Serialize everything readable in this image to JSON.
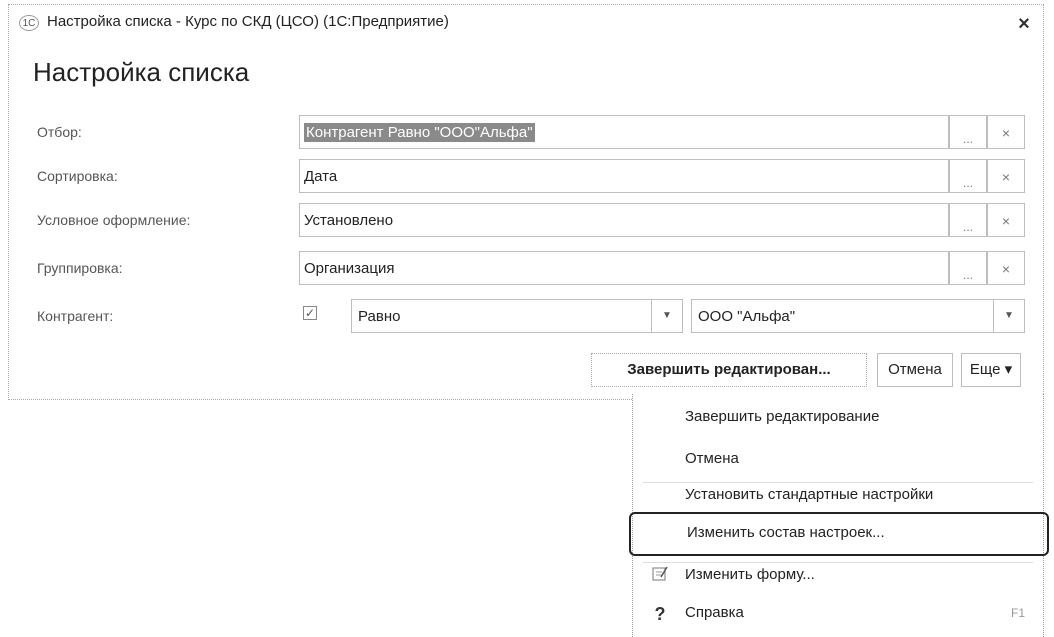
{
  "window": {
    "title": "Настройка списка - Курс по СКД (ЦСО)  (1С:Предприятие)",
    "app_icon": "1С",
    "close_glyph": "×"
  },
  "form": {
    "title": "Настройка списка",
    "rows": [
      {
        "label": "Отбор:",
        "value": "Контрагент Равно \"ООО\"Альфа\"",
        "dots": "...",
        "clear": "×"
      },
      {
        "label": "Сортировка:",
        "value": "Дата",
        "dots": "...",
        "clear": "×"
      },
      {
        "label": "Условное оформление:",
        "value": "Установлено",
        "dots": "...",
        "clear": "×"
      },
      {
        "label": "Группировка:",
        "value": "Организация",
        "dots": "...",
        "clear": "×"
      },
      {
        "label": "Контрагент:",
        "checked": "✓",
        "comparison": "Равно",
        "value": "ООО \"Альфа\""
      }
    ]
  },
  "buttons": {
    "finish": "Завершить редактирован...",
    "cancel": "Отмена",
    "more": "Еще ▾"
  },
  "menu": {
    "items": [
      {
        "label": "Завершить редактирование"
      },
      {
        "label": "Отмена"
      },
      {
        "label": "Установить стандартные настройки"
      },
      {
        "label": "Изменить состав настроек..."
      },
      {
        "label": "Изменить форму...",
        "icon": "form-edit-icon"
      },
      {
        "label": "Справка",
        "icon": "help-icon",
        "icon_glyph": "?",
        "shortcut": "F1"
      }
    ]
  },
  "colors": {
    "selection_bg": "#8a8a8a",
    "border": "#bdbdbd"
  }
}
